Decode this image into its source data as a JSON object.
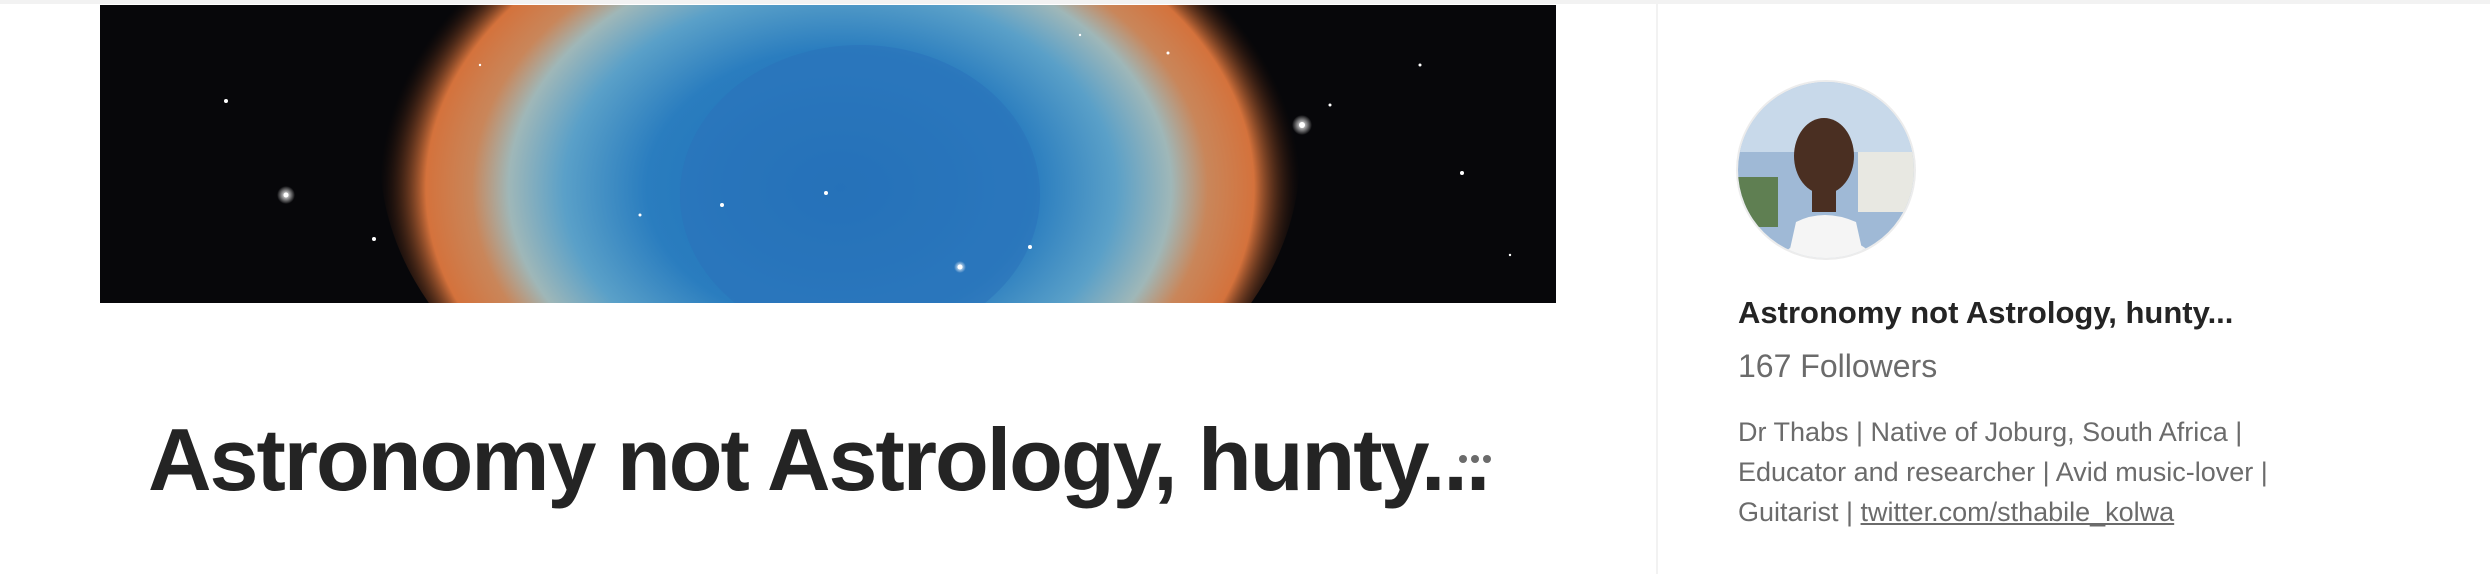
{
  "publication": {
    "title": "Astronomy not Astrology, hunty...",
    "banner_image": "helix-nebula-banner",
    "more_icon": "more-horizontal-icon"
  },
  "sidebar": {
    "avatar_image": "author-avatar-photo",
    "name": "Astronomy not Astrology, hunty...",
    "followers": "167 Followers",
    "bio_line_1": "Dr Thabs | Native of Joburg, South Africa |",
    "bio_line_2": "Educator and researcher | Avid music-lover |",
    "bio_line_3_prefix": "Guitarist | ",
    "bio_link": "twitter.com/sthabile_kolwa"
  },
  "colors": {
    "text_primary": "#242424",
    "text_secondary": "#6b6b6b",
    "divider": "#f2f2f2"
  }
}
